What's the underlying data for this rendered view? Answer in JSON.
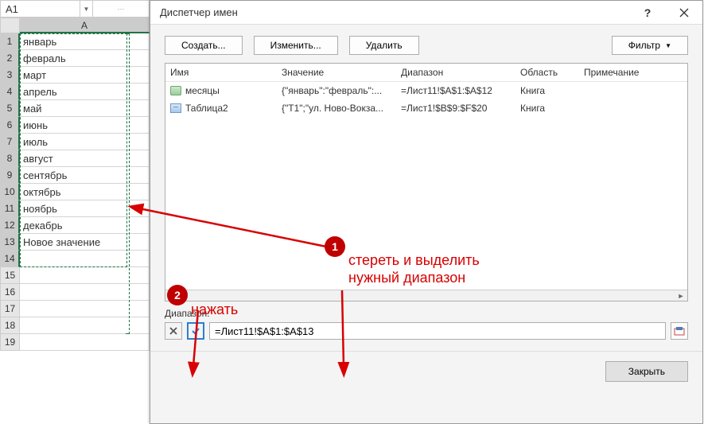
{
  "name_box": "A1",
  "col_header": "A",
  "rows": [
    "январь",
    "февраль",
    "март",
    "апрель",
    "май",
    "июнь",
    "июль",
    "август",
    "сентябрь",
    "октябрь",
    "ноябрь",
    "декабрь",
    "Новое значение",
    "",
    "",
    "",
    "",
    "",
    ""
  ],
  "dialog": {
    "title": "Диспетчер имен",
    "buttons": {
      "create": "Создать...",
      "edit": "Изменить...",
      "delete": "Удалить",
      "filter": "Фильтр"
    },
    "columns": {
      "name": "Имя",
      "value": "Значение",
      "range": "Диапазон",
      "scope": "Область",
      "note": "Примечание"
    },
    "items": [
      {
        "icon": "def",
        "name": "месяцы",
        "value": "{\"январь\":\"февраль\":...",
        "range": "=Лист11!$A$1:$A$12",
        "scope": "Книга"
      },
      {
        "icon": "tbl",
        "name": "Таблица2",
        "value": "{\"Т1\";\"ул. Ново-Вокза...",
        "range": "=Лист1!$B$9:$F$20",
        "scope": "Книга"
      }
    ],
    "range_label": "Диапазон:",
    "range_formula": "=Лист11!$A$1:$A$13",
    "close": "Закрыть"
  },
  "annotations": {
    "step1": "1",
    "step1_text": "стереть и выделить\nнужный диапазон",
    "step2": "2",
    "step2_text": "нажать"
  }
}
